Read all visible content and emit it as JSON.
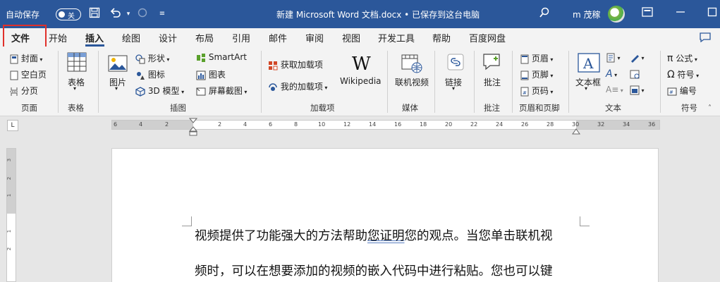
{
  "titlebar": {
    "autosave_label": "自动保存",
    "autosave_state": "关",
    "doc_title": "新建 Microsoft Word 文档.docx • 已保存到这台电脑",
    "user_name": "m 茂稼"
  },
  "tabs": [
    "文件",
    "开始",
    "插入",
    "绘图",
    "设计",
    "布局",
    "引用",
    "邮件",
    "审阅",
    "视图",
    "开发工具",
    "帮助",
    "百度网盘"
  ],
  "ribbon": {
    "pages": {
      "cover": "封面",
      "blank": "空白页",
      "break": "分页",
      "group": "页面"
    },
    "table": {
      "label": "表格",
      "group": "表格"
    },
    "illustrations": {
      "picture": "图片",
      "shapes": "形状",
      "icons": "图标",
      "model3d": "3D 模型",
      "smartart": "SmartArt",
      "chart": "图表",
      "screenshot": "屏幕截图",
      "group": "插图"
    },
    "addins": {
      "get": "获取加载项",
      "my": "我的加载项",
      "wikipedia": "Wikipedia",
      "group": "加载项"
    },
    "media": {
      "video": "联机视频",
      "group": "媒体"
    },
    "links": {
      "link": "链接"
    },
    "comments": {
      "comment": "批注",
      "group": "批注"
    },
    "header_footer": {
      "header": "页眉",
      "footer": "页脚",
      "pagenum": "页码",
      "group": "页眉和页脚"
    },
    "text": {
      "textbox": "文本框",
      "group": "文本"
    },
    "symbols": {
      "equation": "公式",
      "symbol": "符号",
      "number": "编号",
      "group": "符号"
    }
  },
  "ruler": {
    "ticks": [
      "6",
      "4",
      "2",
      "2",
      "4",
      "6",
      "8",
      "10",
      "12",
      "14",
      "16",
      "18",
      "20",
      "22",
      "24",
      "26",
      "28",
      "30",
      "32",
      "34",
      "36"
    ],
    "tab_selector": "L",
    "vticks": [
      "3",
      "2",
      "1",
      "1",
      "2"
    ]
  },
  "document": {
    "line1_before": "视频提供了功能强大的方法帮助",
    "line1_error": "您证明",
    "line1_after": "您的观点。当您单击联机视",
    "line2": "频时，可以在想要添加的视频的嵌入代码中进行粘贴。您也可以键"
  },
  "colors": {
    "accent": "#2b579a",
    "highlight_box": "#e0302a"
  }
}
